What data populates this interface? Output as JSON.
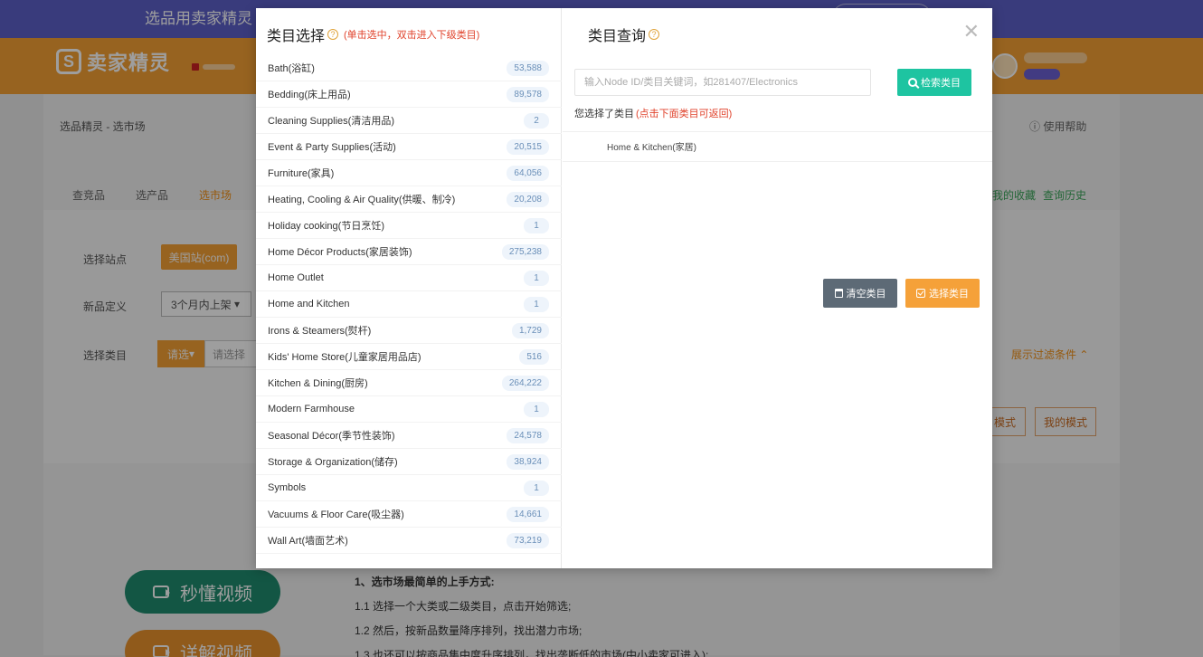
{
  "background": {
    "promo_text": "选品用卖家精灵",
    "logo_mark": "S",
    "logo_name": "卖家精灵",
    "breadcrumb": "选品精灵 - 选市场",
    "help_link": "使用帮助",
    "tabs": [
      {
        "label": "查竞品",
        "active": false
      },
      {
        "label": "选产品",
        "active": false
      },
      {
        "label": "选市场",
        "active": true
      }
    ],
    "favorites_link": "我的收藏",
    "history_link": "查询历史",
    "site_label": "选择站点",
    "site_value": "美国站(com)",
    "newproduct_label": "新品定义",
    "newproduct_value": "3个月内上架",
    "category_label": "选择类目",
    "category_button": "请选",
    "category_input": "请选择",
    "expand_filters": "展示过滤条件",
    "mode_button_1": "模式",
    "mode_button_2": "我的模式",
    "video_1": "秒懂视频",
    "video_2": "详解视频",
    "guide": [
      "1、选市场最简单的上手方式:",
      "1.1 选择一个大类或二级类目，点击开始筛选;",
      "1.2 然后，按新品数量降序排列，找出潜力市场;",
      "1.3 也还可以按商品集中度升序排列，找出垄断低的市场(中小卖家可进入);"
    ],
    "colors": {
      "topbar": "#5d5fc8",
      "mainbar": "#f4a035"
    }
  },
  "modal": {
    "left_title": "类目选择",
    "left_hint": "(单击选中，双击进入下级类目)",
    "categories": [
      {
        "name": "Bath(浴缸)",
        "count": "53,588"
      },
      {
        "name": "Bedding(床上用品)",
        "count": "89,578"
      },
      {
        "name": "Cleaning Supplies(清洁用品)",
        "count": "2"
      },
      {
        "name": "Event & Party Supplies(活动)",
        "count": "20,515"
      },
      {
        "name": "Furniture(家具)",
        "count": "64,056"
      },
      {
        "name": "Heating, Cooling & Air Quality(供暖、制冷)",
        "count": "20,208"
      },
      {
        "name": "Holiday cooking(节日烹饪)",
        "count": "1"
      },
      {
        "name": "Home Décor Products(家居装饰)",
        "count": "275,238"
      },
      {
        "name": "Home Outlet",
        "count": "1"
      },
      {
        "name": "Home and Kitchen",
        "count": "1"
      },
      {
        "name": "Irons & Steamers(熨杆)",
        "count": "1,729"
      },
      {
        "name": "Kids' Home Store(儿童家居用品店)",
        "count": "516"
      },
      {
        "name": "Kitchen & Dining(厨房)",
        "count": "264,222"
      },
      {
        "name": "Modern Farmhouse",
        "count": "1"
      },
      {
        "name": "Seasonal Décor(季节性装饰)",
        "count": "24,578"
      },
      {
        "name": "Storage & Organization(储存)",
        "count": "38,924"
      },
      {
        "name": "Symbols",
        "count": "1"
      },
      {
        "name": "Vacuums & Floor Care(吸尘器)",
        "count": "14,661"
      },
      {
        "name": "Wall Art(墙面艺术)",
        "count": "73,219"
      }
    ],
    "right_title": "类目查询",
    "search_placeholder": "输入Node ID/类目关键词，如281407/Electronics",
    "search_button": "检索类目",
    "selected_label": "您选择了类目",
    "selected_hint": "(点击下面类目可返回)",
    "selected_path": "Home & Kitchen(家居)",
    "clear_button": "清空类目",
    "choose_button": "选择类目",
    "colors": {
      "search_button": "#1ec4a1",
      "clear_button": "#5d6a76",
      "choose_button": "#f5a139",
      "hint": "#e0422b"
    }
  }
}
